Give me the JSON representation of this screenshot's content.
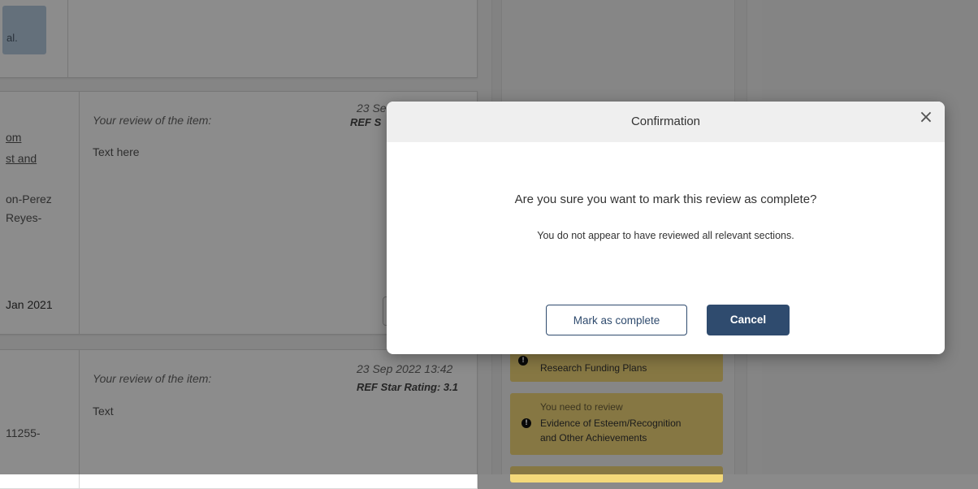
{
  "background": {
    "top_card": {
      "tag_text": "al."
    },
    "card1": {
      "author_lines": [
        "om",
        "st and",
        "on-Perez",
        "Reyes-"
      ],
      "date": "Jan 2021",
      "review_label": "Your review of the item:",
      "review_text": "Text here",
      "timestamp": "23 Se",
      "rating": "REF S"
    },
    "card2": {
      "author_line": "11255-",
      "review_label": "Your review of the item:",
      "review_text": "Text",
      "timestamp": "23 Sep 2022 13:42",
      "rating": "REF Star Rating: 3.1"
    },
    "sidebar": {
      "item1_label": "Research Funding Plans",
      "item2_prefix": "You need to review",
      "item2_label_line1": "Evidence of Esteem/Recognition",
      "item2_label_line2": "and Other Achievements"
    }
  },
  "modal": {
    "title": "Confirmation",
    "close_symbol": "×",
    "message": "Are you sure you want to mark this review as complete?",
    "sub_message": "You do not appear to have reviewed all relevant sections.",
    "confirm_label": "Mark as complete",
    "cancel_label": "Cancel"
  },
  "colors": {
    "primary": "#2f4b6e",
    "warning_bg": "#f4d97a",
    "overlay": "rgba(0,0,0,0.45)"
  }
}
